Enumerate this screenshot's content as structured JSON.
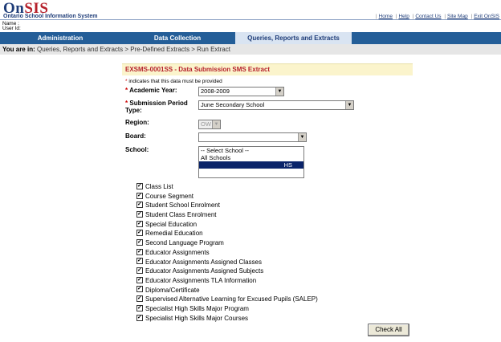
{
  "header": {
    "logo_on": "On",
    "logo_sis": "SIS",
    "system_name": "Ontario School Information System",
    "name_label": "Name :",
    "userid_label": "User Id:",
    "links": [
      "Home",
      "Help",
      "Contact Us",
      "Site Map",
      "Exit OnSIS"
    ]
  },
  "nav": {
    "tabs": [
      "Administration",
      "Data Collection",
      "Queries, Reports and Extracts"
    ],
    "active_index": 2
  },
  "breadcrumb": {
    "prefix": "You are in:",
    "path": "Queries, Reports and Extracts > Pre-Defined Extracts > Run Extract"
  },
  "form": {
    "title": "EXSMS-0001SS - Data Submission SMS Extract",
    "required_note": "indicates that this data must be provided",
    "academic_year_label": "Academic Year:",
    "academic_year_value": "2008-2009",
    "submission_period_label": "Submission Period Type:",
    "submission_period_value": "June Secondary School",
    "region_label": "Region:",
    "region_value": "OW",
    "board_label": "Board:",
    "board_value": "",
    "school_label": "School:",
    "school_options": [
      "-- Select School --",
      "All Schools",
      "HS"
    ],
    "selected_school_index": 2
  },
  "checkboxes": [
    "Class List",
    "Course Segment",
    "Student School Enrolment",
    "Student Class Enrolment",
    "Special Education",
    "Remedial Education",
    "Second Language Program",
    "Educator Assignments",
    "Educator Assignments Assigned Classes",
    "Educator Assignments Assigned Subjects",
    "Educator Assignments TLA Information",
    "Diploma/Certificate",
    "Supervised Alternative Learning for Excused Pupils (SALEP)",
    "Specialist High Skills Major Program",
    "Specialist High Skills Major Courses"
  ],
  "check_all_label": "Check All",
  "colors": {
    "nav_bg": "#245e98",
    "title_red": "#b51f2a",
    "title_bg": "#fbf4cc"
  }
}
